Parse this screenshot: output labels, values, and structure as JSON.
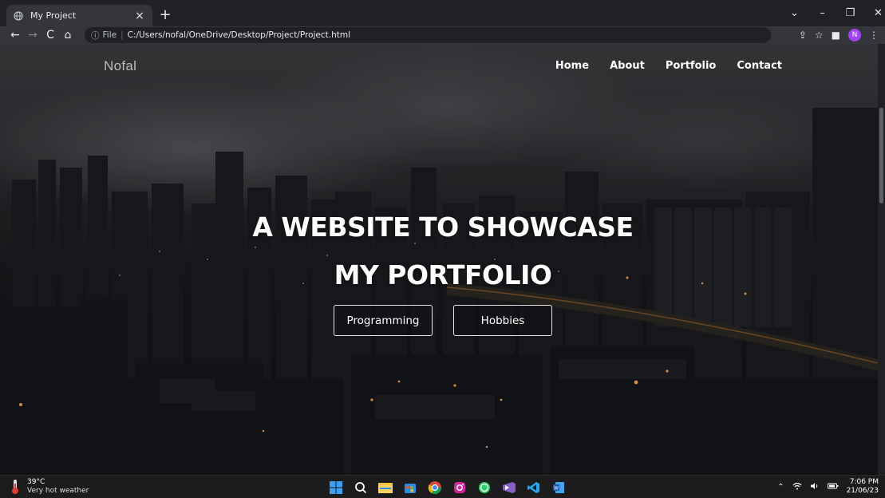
{
  "browser": {
    "tab_title": "My Project",
    "url_prefix": "File",
    "url": "C:/Users/nofal/OneDrive/Desktop/Project/Project.html"
  },
  "site": {
    "logo": "Nofal",
    "menu": [
      {
        "label": "Home"
      },
      {
        "label": "About"
      },
      {
        "label": "Portfolio"
      },
      {
        "label": "Contact"
      }
    ],
    "hero_line1": "A WEBSITE TO SHOWCASE",
    "hero_line2": "MY PORTFOLIO",
    "buttons": [
      {
        "label": "Programming"
      },
      {
        "label": "Hobbies"
      }
    ]
  },
  "profile_initial": "N",
  "taskbar": {
    "temperature": "39°C",
    "weather": "Very hot weather",
    "time": "7:06 PM",
    "date": "21/06/23"
  },
  "colors": {
    "chrome_dark": "#202124",
    "chrome_mid": "#35363a",
    "profile": "#a142f4",
    "taskbar": "#1c1c1c"
  }
}
